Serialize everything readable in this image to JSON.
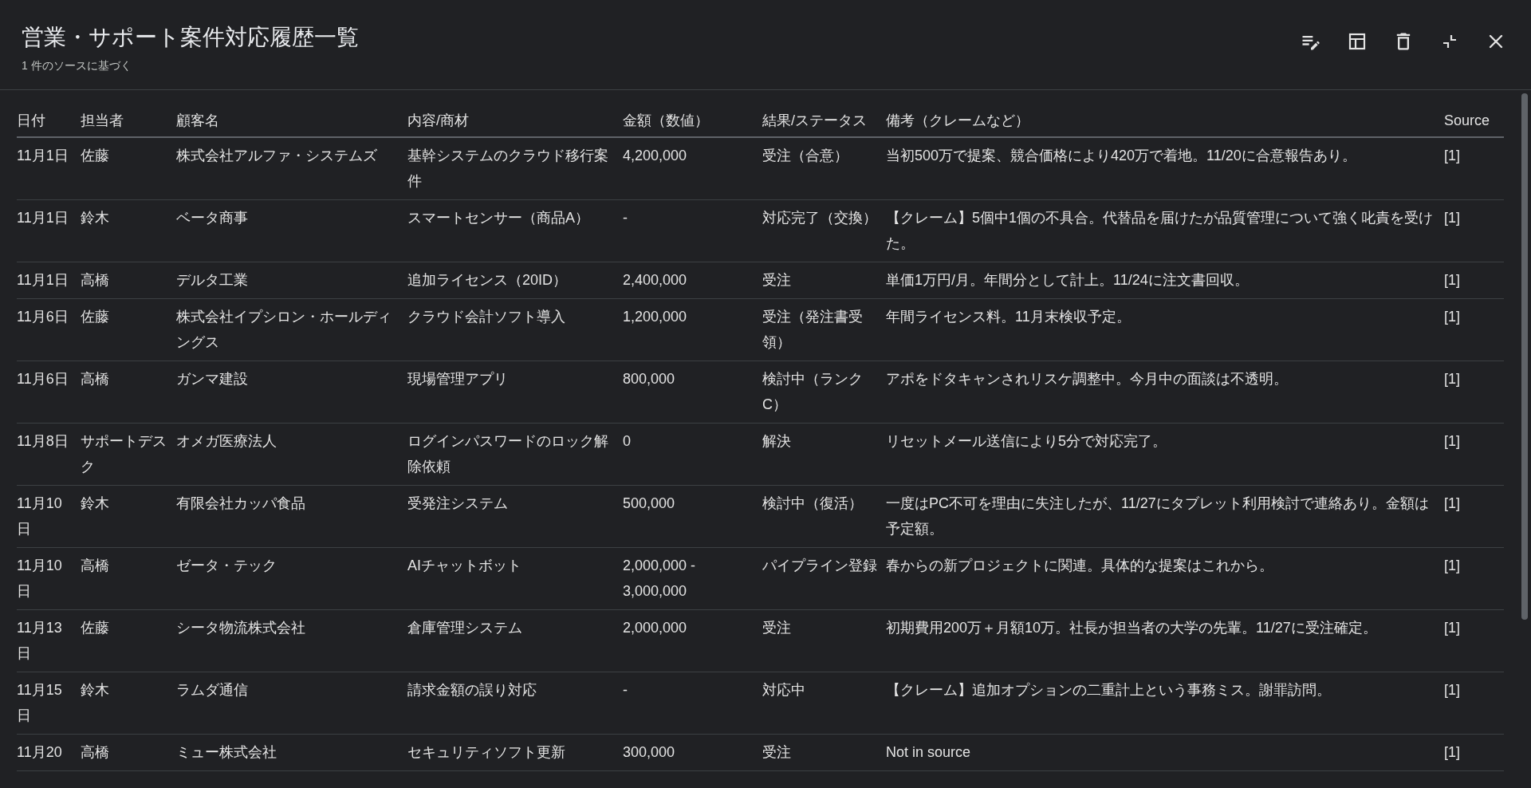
{
  "window": {
    "title": "営業・サポート案件対応履歴一覧",
    "subtitle": "1 件のソースに基づく"
  },
  "table": {
    "columns": [
      "日付",
      "担当者",
      "顧客名",
      "内容/商材",
      "金額（数値）",
      "結果/ステータス",
      "備考（クレームなど）",
      "Source"
    ],
    "rows": [
      [
        "11月1日",
        "佐藤",
        "株式会社アルファ・システムズ",
        "基幹システムのクラウド移行案件",
        "4,200,000",
        "受注（合意）",
        "当初500万で提案、競合価格により420万で着地。11/20に合意報告あり。",
        "[1]"
      ],
      [
        "11月1日",
        "鈴木",
        "ベータ商事",
        "スマートセンサー（商品A）",
        "-",
        "対応完了（交換）",
        "【クレーム】5個中1個の不具合。代替品を届けたが品質管理について強く叱責を受けた。",
        "[1]"
      ],
      [
        "11月1日",
        "高橋",
        "デルタ工業",
        "追加ライセンス（20ID）",
        "2,400,000",
        "受注",
        "単価1万円/月。年間分として計上。11/24に注文書回収。",
        "[1]"
      ],
      [
        "11月6日",
        "佐藤",
        "株式会社イプシロン・ホールディングス",
        "クラウド会計ソフト導入",
        "1,200,000",
        "受注（発注書受領）",
        "年間ライセンス料。11月末検収予定。",
        "[1]"
      ],
      [
        "11月6日",
        "高橋",
        "ガンマ建設",
        "現場管理アプリ",
        "800,000",
        "検討中（ランクC）",
        "アポをドタキャンされリスケ調整中。今月中の面談は不透明。",
        "[1]"
      ],
      [
        "11月8日",
        "サポートデスク",
        "オメガ医療法人",
        "ログインパスワードのロック解除依頼",
        "0",
        "解決",
        "リセットメール送信により5分で対応完了。",
        "[1]"
      ],
      [
        "11月10日",
        "鈴木",
        "有限会社カッパ食品",
        "受発注システム",
        "500,000",
        "検討中（復活）",
        "一度はPC不可を理由に失注したが、11/27にタブレット利用検討で連絡あり。金額は予定額。",
        "[1]"
      ],
      [
        "11月10日",
        "高橋",
        "ゼータ・テック",
        "AIチャットボット",
        "2,000,000 - 3,000,000",
        "パイプライン登録",
        "春からの新プロジェクトに関連。具体的な提案はこれから。",
        "[1]"
      ],
      [
        "11月13日",
        "佐藤",
        "シータ物流株式会社",
        "倉庫管理システム",
        "2,000,000",
        "受注",
        "初期費用200万＋月額10万。社長が担当者の大学の先輩。11/27に受注確定。",
        "[1]"
      ],
      [
        "11月15日",
        "鈴木",
        "ラムダ通信",
        "請求金額の誤り対応",
        "-",
        "対応中",
        "【クレーム】追加オプションの二重計上という事務ミス。謝罪訪問。",
        "[1]"
      ],
      [
        "11月20",
        "高橋",
        "ミュー株式会社",
        "セキュリティソフト更新",
        "300,000",
        "受注",
        "Not in source",
        "[1]"
      ]
    ]
  }
}
